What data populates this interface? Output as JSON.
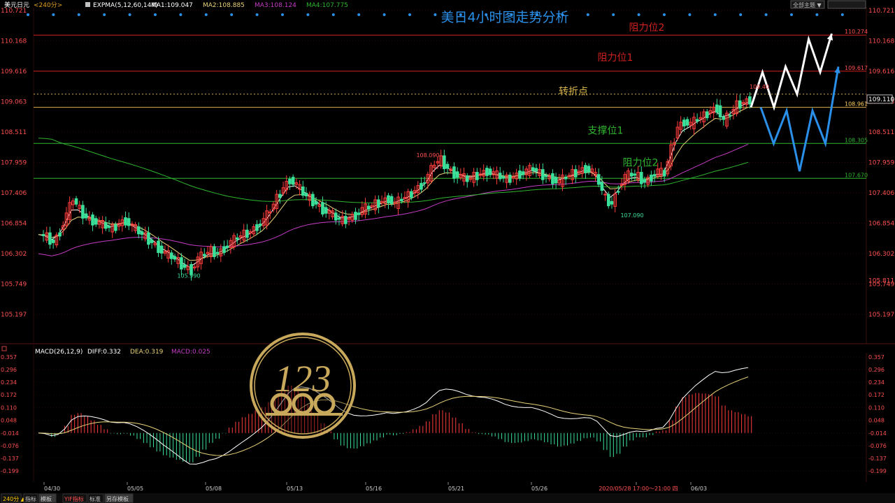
{
  "header": {
    "symbol": "美元日元",
    "period_tag": "<240分>",
    "indicator_prefix": "EXPMA(5,12,60,144)",
    "ma1": "MA1:109.047",
    "ma2": "MA2:108.885",
    "ma3": "MA3:108.124",
    "ma4": "MA4:107.775",
    "theme_button": "全部主题 ▼"
  },
  "title": "美日4小时图走势分析",
  "colors": {
    "up": "#ff3c3c",
    "down": "#3be09a",
    "ma1": "#ffffff",
    "ma2": "#e8d27a",
    "ma3": "#c43cc4",
    "ma4": "#2fb52f",
    "resistance": "#d02020",
    "support": "#2fb52f",
    "pivot": "#d6b34a",
    "title": "#2a8fe8",
    "axis_text": "#ff5050"
  },
  "price_axis": {
    "ticks": [
      "110.721",
      "110.168",
      "109.616",
      "109.063",
      "108.511",
      "107.959",
      "107.406",
      "106.854",
      "106.302",
      "105.749",
      "105.197"
    ],
    "right_extra": "105.811",
    "current_price": "109.110"
  },
  "levels": [
    {
      "name": "阻力位2",
      "price": 110.274,
      "label": "110.274",
      "color": "#d02020"
    },
    {
      "name": "阻力位1",
      "price": 109.617,
      "label": "109.617",
      "color": "#d02020"
    },
    {
      "name": "转折点",
      "price": 108.961,
      "label": "108.961",
      "color": "#d6b34a"
    },
    {
      "name": "支撑位1",
      "price": 108.305,
      "label": "108.305",
      "color": "#2fb52f"
    },
    {
      "name": "阻力位2",
      "price": 107.67,
      "label": "107.670",
      "color": "#2fb52f"
    }
  ],
  "annotations": {
    "high": "108.090",
    "low1": "105.990",
    "low2": "107.090",
    "last": "109.40"
  },
  "macd": {
    "label": "MACD(26,12,9)",
    "diff": "DIFF:0.332",
    "dea": "DEA:0.319",
    "macd": "MACD:0.025",
    "ticks": [
      "0.357",
      "0.296",
      "0.234",
      "0.172",
      "0.110",
      "0.048",
      "-0.014",
      "-0.076",
      "-0.137",
      "-0.199"
    ]
  },
  "dates": [
    "04/30",
    "05/05",
    "05/08",
    "05/13",
    "05/16",
    "05/21",
    "05/26",
    "2020/05/28 17:00～21:00 四",
    "06/03"
  ],
  "bottom_tabs": [
    "240分 ▲",
    "指标",
    "模板",
    "YIF指标",
    "标准",
    "另存模板"
  ],
  "logo_text": "123",
  "chart_data": {
    "type": "candlestick",
    "title": "美日4小时图走势分析",
    "ylim": [
      104.9,
      110.721
    ],
    "x_categories": [
      "04/30",
      "05/05",
      "05/08",
      "05/13",
      "05/16",
      "05/21",
      "05/26",
      "2020/05/28 17:00～21:00 四",
      "06/03"
    ],
    "close_path": [
      106.65,
      106.6,
      106.5,
      106.7,
      107.0,
      107.3,
      107.1,
      106.95,
      106.9,
      106.85,
      106.8,
      106.75,
      106.85,
      106.9,
      106.8,
      106.7,
      106.6,
      106.5,
      106.4,
      106.3,
      106.25,
      106.15,
      106.05,
      106.0,
      106.2,
      106.3,
      106.35,
      106.3,
      106.4,
      106.5,
      106.6,
      106.65,
      106.7,
      106.8,
      106.9,
      107.1,
      107.3,
      107.5,
      107.65,
      107.55,
      107.4,
      107.3,
      107.2,
      107.1,
      107.05,
      106.95,
      106.9,
      106.95,
      107.0,
      107.1,
      107.15,
      107.2,
      107.25,
      107.3,
      107.2,
      107.3,
      107.35,
      107.45,
      107.55,
      107.7,
      107.95,
      108.0,
      107.85,
      107.75,
      107.7,
      107.65,
      107.7,
      107.75,
      107.8,
      107.75,
      107.7,
      107.65,
      107.7,
      107.75,
      107.8,
      107.85,
      107.75,
      107.7,
      107.65,
      107.6,
      107.7,
      107.75,
      107.8,
      107.85,
      107.8,
      107.6,
      107.3,
      107.2,
      107.5,
      107.7,
      107.75,
      107.7,
      107.6,
      107.7,
      107.8,
      107.75,
      108.2,
      108.6,
      108.7,
      108.65,
      108.75,
      108.8,
      108.9,
      108.95,
      108.7,
      108.85,
      109.0,
      109.05,
      109.1
    ],
    "ma_series_names": [
      "MA1",
      "MA2",
      "MA3",
      "MA4"
    ],
    "projection": {
      "white_zigzag": [
        108.96,
        109.6,
        108.96,
        109.7,
        109.2,
        110.2,
        109.6,
        110.3
      ],
      "blue_zigzag": [
        108.96,
        108.3,
        108.9,
        107.8,
        108.9,
        108.3,
        109.7
      ]
    },
    "macd": {
      "diff_last": 0.332,
      "dea_last": 0.319,
      "macd_last": 0.025,
      "ylim": [
        -0.23,
        0.37
      ]
    }
  }
}
